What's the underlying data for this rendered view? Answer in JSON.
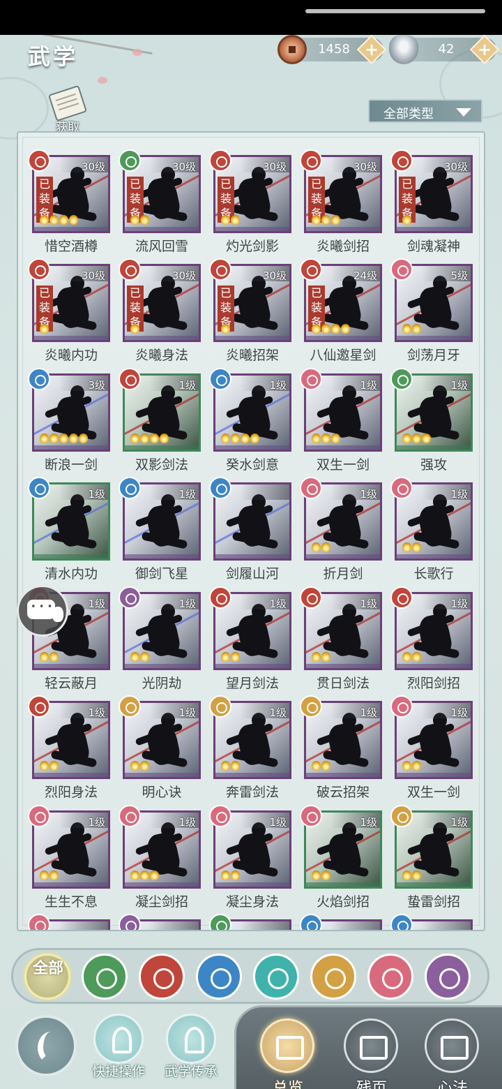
{
  "header": {
    "title": "武学"
  },
  "currencies": [
    {
      "icon": "copper-coin-icon",
      "value": "1458"
    },
    {
      "icon": "silver-ingot-icon",
      "value": "42"
    }
  ],
  "acquire_label": "获取",
  "filter": {
    "label": "全部类型"
  },
  "skills": [
    {
      "name": "惜空酒樽",
      "level": "30级",
      "equipped": "已装备",
      "element": "fire",
      "pips": 4
    },
    {
      "name": "流风回雪",
      "level": "30级",
      "equipped": "已装备",
      "element": "wind",
      "pips": 2
    },
    {
      "name": "灼光剑影",
      "level": "30级",
      "equipped": "已装备",
      "element": "fire",
      "pips": 2
    },
    {
      "name": "炎曦剑招",
      "level": "30级",
      "equipped": "已装备",
      "element": "fire",
      "pips": 3
    },
    {
      "name": "剑魂凝神",
      "level": "30级",
      "equipped": "已装备",
      "element": "fire",
      "pips": 1
    },
    {
      "name": "炎曦内功",
      "level": "30级",
      "equipped": "已装备",
      "element": "fire",
      "pips": 1
    },
    {
      "name": "炎曦身法",
      "level": "30级",
      "equipped": "已装备",
      "element": "fire",
      "pips": 1
    },
    {
      "name": "炎曦招架",
      "level": "30级",
      "equipped": "已装备",
      "element": "fire",
      "pips": 1
    },
    {
      "name": "八仙邀星剑",
      "level": "24级",
      "equipped": "已装备",
      "element": "fire",
      "pips": 4
    },
    {
      "name": "剑荡月牙",
      "level": "5级",
      "equipped": "",
      "element": "moon",
      "pips": 2
    },
    {
      "name": "断浪一剑",
      "level": "3级",
      "equipped": "",
      "element": "water",
      "pips": 5
    },
    {
      "name": "双影剑法",
      "level": "1级",
      "equipped": "",
      "element": "fire",
      "pips": 4
    },
    {
      "name": "癸水剑意",
      "level": "1级",
      "equipped": "",
      "element": "water",
      "pips": 4
    },
    {
      "name": "双生一剑",
      "level": "1级",
      "equipped": "",
      "element": "moon",
      "pips": 3
    },
    {
      "name": "强攻",
      "level": "1级",
      "equipped": "",
      "element": "wind",
      "pips": 3
    },
    {
      "name": "清水内功",
      "level": "1级",
      "equipped": "",
      "element": "water",
      "pips": 0
    },
    {
      "name": "御剑飞星",
      "level": "1级",
      "equipped": "",
      "element": "water",
      "pips": 0
    },
    {
      "name": "剑履山河",
      "level": "",
      "equipped": "",
      "element": "water",
      "pips": 0
    },
    {
      "name": "折月剑",
      "level": "1级",
      "equipped": "",
      "element": "moon",
      "pips": 2
    },
    {
      "name": "长歌行",
      "level": "1级",
      "equipped": "",
      "element": "moon",
      "pips": 2
    },
    {
      "name": "轻云蔽月",
      "level": "1级",
      "equipped": "",
      "element": "moon",
      "pips": 2
    },
    {
      "name": "光阴劫",
      "level": "1级",
      "equipped": "",
      "element": "rose",
      "pips": 2
    },
    {
      "name": "望月剑法",
      "level": "1级",
      "equipped": "",
      "element": "fire",
      "pips": 2
    },
    {
      "name": "贯日剑法",
      "level": "1级",
      "equipped": "",
      "element": "fire",
      "pips": 2
    },
    {
      "name": "烈阳剑招",
      "level": "1级",
      "equipped": "",
      "element": "fire",
      "pips": 2
    },
    {
      "name": "烈阳身法",
      "level": "1级",
      "equipped": "",
      "element": "fire",
      "pips": 2
    },
    {
      "name": "明心诀",
      "level": "1级",
      "equipped": "",
      "element": "shield",
      "pips": 2
    },
    {
      "name": "奔雷剑法",
      "level": "1级",
      "equipped": "",
      "element": "shield",
      "pips": 2
    },
    {
      "name": "破云招架",
      "level": "1级",
      "equipped": "",
      "element": "shield",
      "pips": 2
    },
    {
      "name": "双生一剑",
      "level": "1级",
      "equipped": "",
      "element": "moon",
      "pips": 2
    },
    {
      "name": "生生不息",
      "level": "1级",
      "equipped": "",
      "element": "moon",
      "pips": 2
    },
    {
      "name": "凝尘剑招",
      "level": "1级",
      "equipped": "",
      "element": "moon",
      "pips": 3
    },
    {
      "name": "凝尘身法",
      "level": "1级",
      "equipped": "",
      "element": "moon",
      "pips": 2
    },
    {
      "name": "火焰剑招",
      "level": "1级",
      "equipped": "",
      "element": "moon",
      "pips": 2
    },
    {
      "name": "蛰雷剑招",
      "level": "1级",
      "equipped": "",
      "element": "shield",
      "pips": 2
    }
  ],
  "element_tabs": [
    {
      "name": "all",
      "label": "全部"
    },
    {
      "name": "wind"
    },
    {
      "name": "fire"
    },
    {
      "name": "water"
    },
    {
      "name": "butterfly"
    },
    {
      "name": "shield"
    },
    {
      "name": "moon"
    },
    {
      "name": "rose"
    }
  ],
  "tools": [
    {
      "label": "快捷操作",
      "icon": "quick-action-icon"
    },
    {
      "label": "武学传承",
      "icon": "inheritance-icon"
    }
  ],
  "nav": [
    {
      "label": "总览",
      "icon": "book-icon",
      "active": true
    },
    {
      "label": "残页",
      "icon": "puzzle-icon",
      "active": false
    },
    {
      "label": "心法",
      "icon": "mind-icon",
      "active": false
    }
  ],
  "colors": {
    "fire": "#c0453a",
    "wind": "#4d9a5a",
    "water": "#3d86c6",
    "moon": "#d96a7d",
    "rose": "#8a5f9c",
    "shield": "#d3a043",
    "equipped": "#a93a2d"
  }
}
